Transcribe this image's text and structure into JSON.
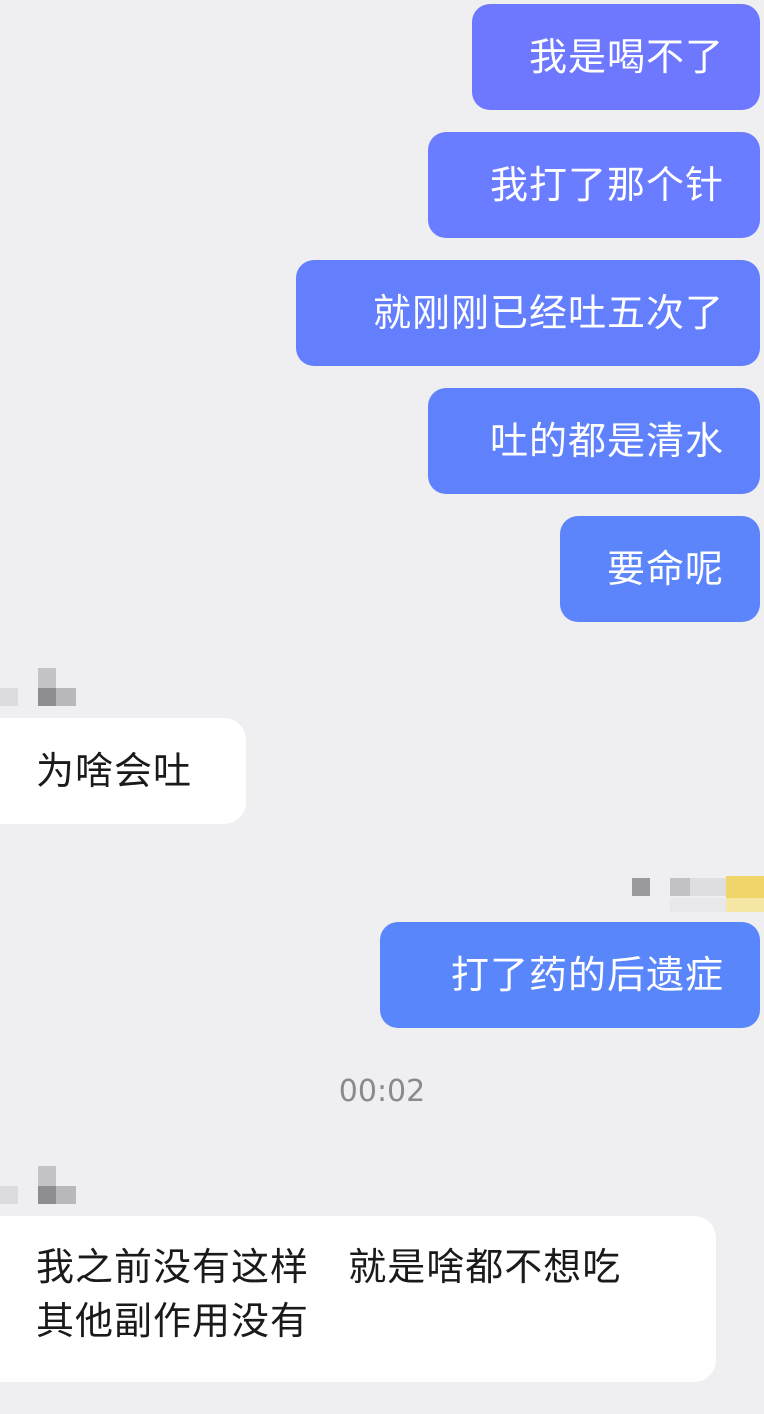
{
  "outgoing_color_1": "#6e7cff",
  "outgoing_color_2": "#5a86fb",
  "messages": {
    "m1": "我是喝不了",
    "m2": "我打了那个针",
    "m3": "就刚刚已经吐五次了",
    "m4": "吐的都是清水",
    "m5": "要命呢",
    "m6": "为啥会吐",
    "m7": "打了药的后遗症",
    "m8_line1": "我之前没有这样   就是啥都不想吃",
    "m8_line2": "其他副作用没有"
  },
  "timestamp": "00:02",
  "avatars": {
    "contact_1": "pixelated-avatar-icon",
    "self": "pixelated-avatar-icon",
    "contact_2": "pixelated-avatar-icon"
  }
}
